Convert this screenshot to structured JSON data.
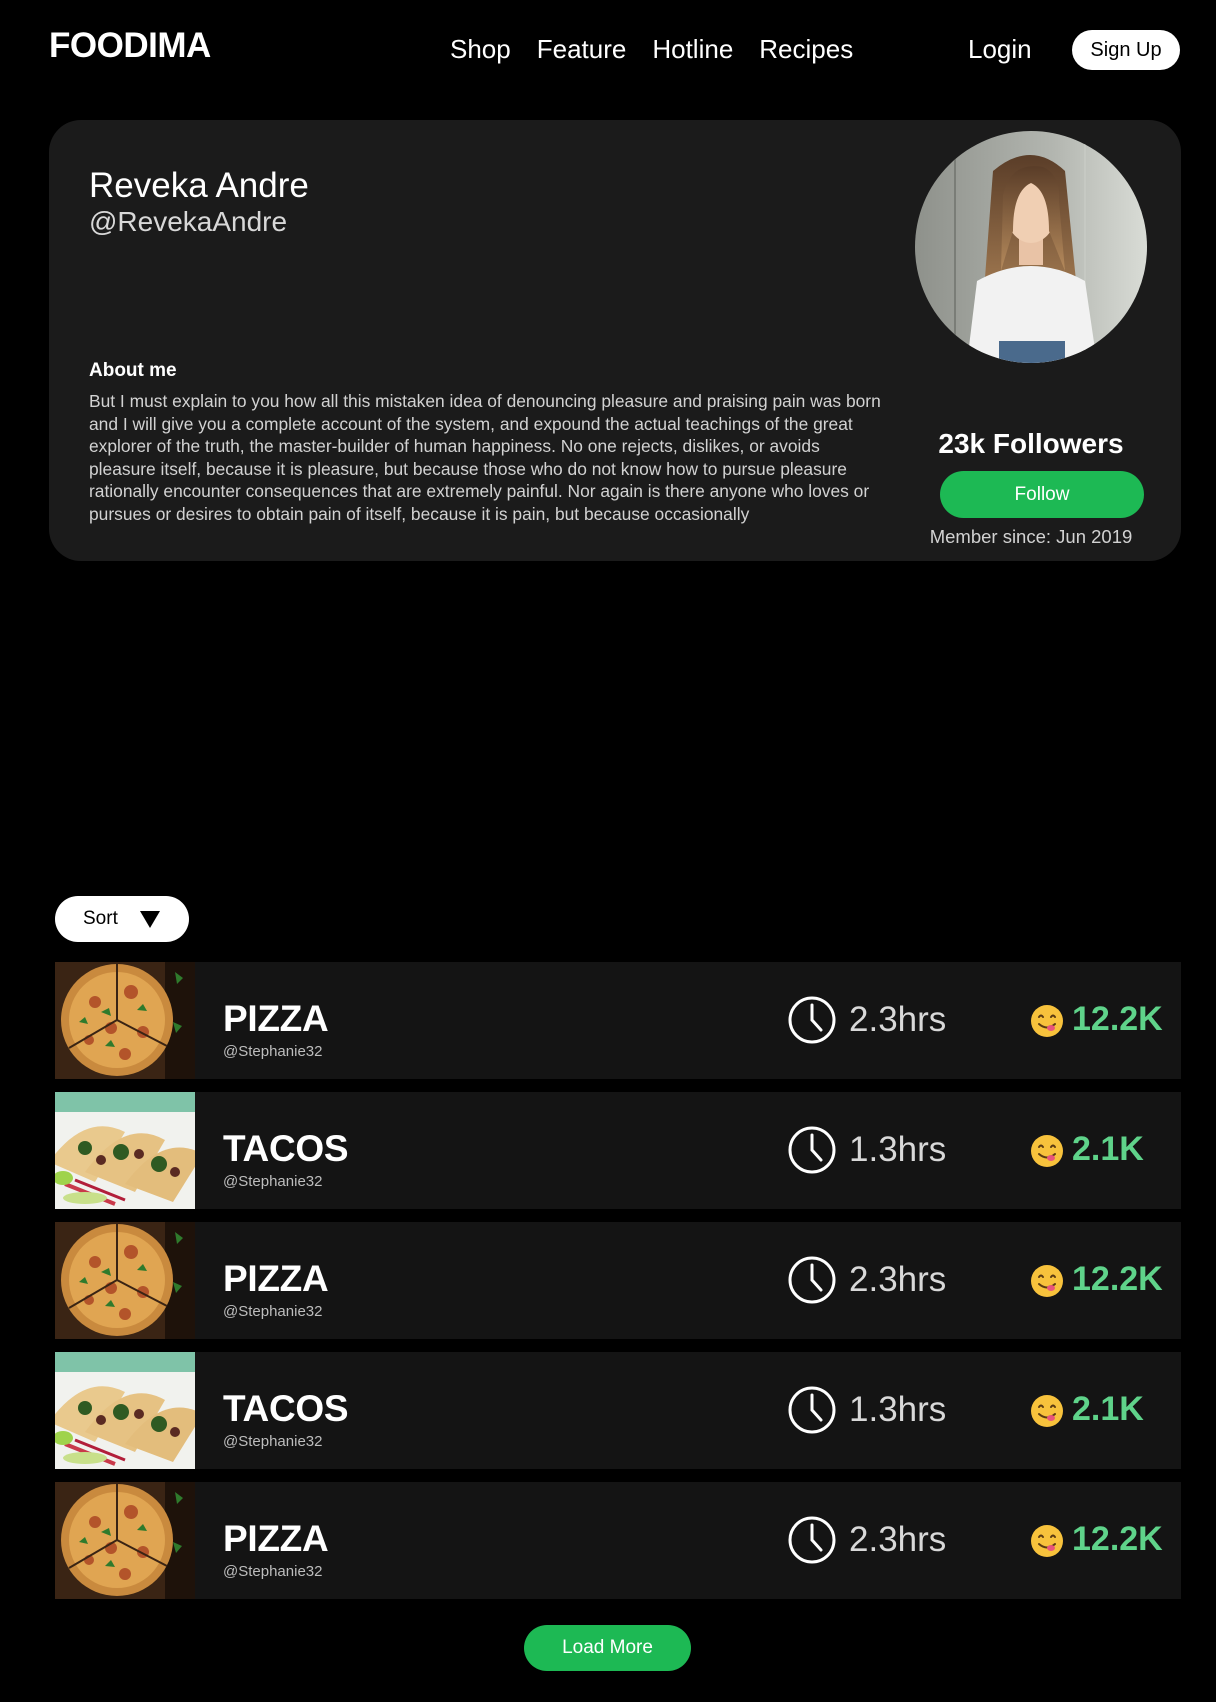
{
  "header": {
    "logo": "FOODIMA",
    "nav": [
      "Shop",
      "Feature",
      "Hotline",
      "Recipes"
    ],
    "login_label": "Login",
    "signup_label": "Sign Up"
  },
  "profile": {
    "name": "Reveka Andre",
    "handle": "@RevekaAndre",
    "about_heading": "About me",
    "about_text": "But I must explain to you how all this mistaken idea of denouncing pleasure and praising pain was born and I will give you a complete account of the system, and expound the actual teachings of the great explorer of the truth, the master-builder of human happiness. No one rejects, dislikes, or avoids pleasure itself, because it is pleasure, but because those who do not know how to pursue pleasure rationally encounter consequences that are extremely painful. Nor again is there anyone who loves or pursues or desires to obtain pain of itself, because it is pain, but because occasionally",
    "followers": "23k Followers",
    "follow_label": "Follow",
    "member_since": "Member since: Jun 2019"
  },
  "sort": {
    "label": "Sort"
  },
  "recipes": [
    {
      "title": "PIZZA",
      "author": "@Stephanie32",
      "time": "2.3hrs",
      "likes": "12.2K",
      "image": "pizza"
    },
    {
      "title": "TACOS",
      "author": "@Stephanie32",
      "time": "1.3hrs",
      "likes": "2.1K",
      "image": "tacos"
    },
    {
      "title": "PIZZA",
      "author": "@Stephanie32",
      "time": "2.3hrs",
      "likes": "12.2K",
      "image": "pizza"
    },
    {
      "title": "TACOS",
      "author": "@Stephanie32",
      "time": "1.3hrs",
      "likes": "2.1K",
      "image": "tacos"
    },
    {
      "title": "PIZZA",
      "author": "@Stephanie32",
      "time": "2.3hrs",
      "likes": "12.2K",
      "image": "pizza"
    }
  ],
  "load_more_label": "Load More",
  "colors": {
    "accent_green": "#1db954",
    "likes_green": "#5fd38a",
    "card_background": "#1b1b1b"
  }
}
